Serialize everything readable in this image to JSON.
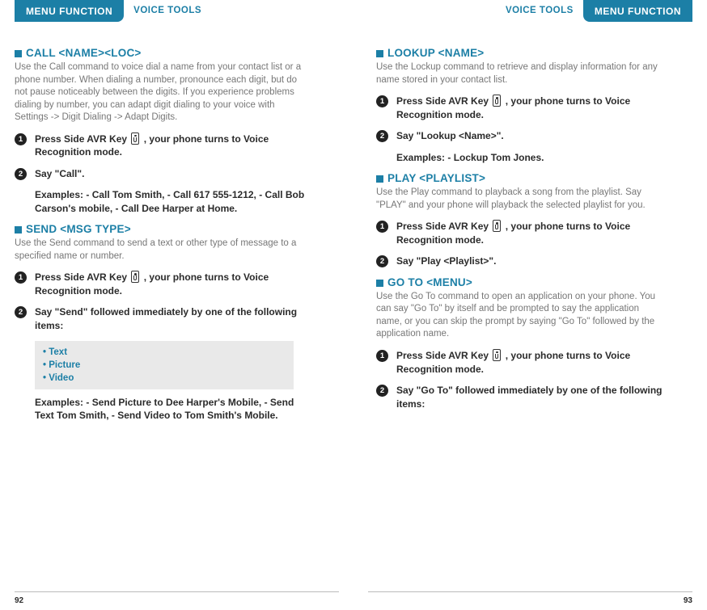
{
  "header": {
    "tab_left": "MENU FUNCTION",
    "crumb_left": "VOICE TOOLS",
    "crumb_right": "VOICE TOOLS",
    "tab_right": "MENU FUNCTION"
  },
  "left": {
    "call": {
      "title": "CALL <NAME><LOC>",
      "desc": "Use the Call command to voice dial a name from your contact list or a phone number.  When dialing a number, pronounce each digit, but do not pause noticeably between the digits. If you experience problems dialing by number, you can adapt digit dialing to your voice with Settings -> Digit Dialing -> Adapt Digits.",
      "step1_a": "Press Side AVR Key ",
      "step1_b": " , your phone turns to Voice Recognition mode.",
      "step2": "Say \"Call\".",
      "examples": "Examples: - Call Tom Smith, - Call 617 555-1212, - Call Bob Carson's mobile, - Call Dee Harper at Home."
    },
    "send": {
      "title": "SEND <MSG TYPE>",
      "desc": "Use the Send command to send a text or other type of message to a specified name or number.",
      "step1_a": "Press Side AVR Key ",
      "step1_b": " , your phone turns to Voice Recognition mode.",
      "step2": "Say \"Send\" followed immediately by one of the following items:",
      "opts": [
        "Text",
        "Picture",
        "Video"
      ],
      "examples": "Examples: - Send Picture to Dee Harper's Mobile, - Send Text Tom Smith, - Send Video to Tom Smith's Mobile."
    },
    "page_num": "92"
  },
  "right": {
    "lookup": {
      "title": "LOOKUP <NAME>",
      "desc": "Use the Lockup command to retrieve and display information for any name stored in your contact list.",
      "step1_a": "Press Side AVR Key ",
      "step1_b": " , your phone turns to Voice Recognition mode.",
      "step2": "Say \"Lookup <Name>\".",
      "examples": "Examples: - Lockup Tom Jones."
    },
    "play": {
      "title": "PLAY <PLAYLIST>",
      "desc": "Use the Play command to playback a song from the playlist. Say \"PLAY\" and your phone will playback the selected playlist for you.",
      "step1_a": "Press Side AVR Key ",
      "step1_b": " , your phone turns to Voice Recognition mode.",
      "step2": "Say \"Play <Playlist>\"."
    },
    "goto": {
      "title": "GO TO <MENU>",
      "desc": "Use the Go To command to open an application on your phone. You can say \"Go To\" by itself and be prompted to say the application name, or you can skip the prompt by saying \"Go To\" followed by the application name.",
      "step1_a": "Press Side AVR Key ",
      "step1_b": " , your phone turns to Voice Recognition mode.",
      "step2": "Say \"Go To\" followed immediately by one of the following items:"
    },
    "page_num": "93"
  }
}
